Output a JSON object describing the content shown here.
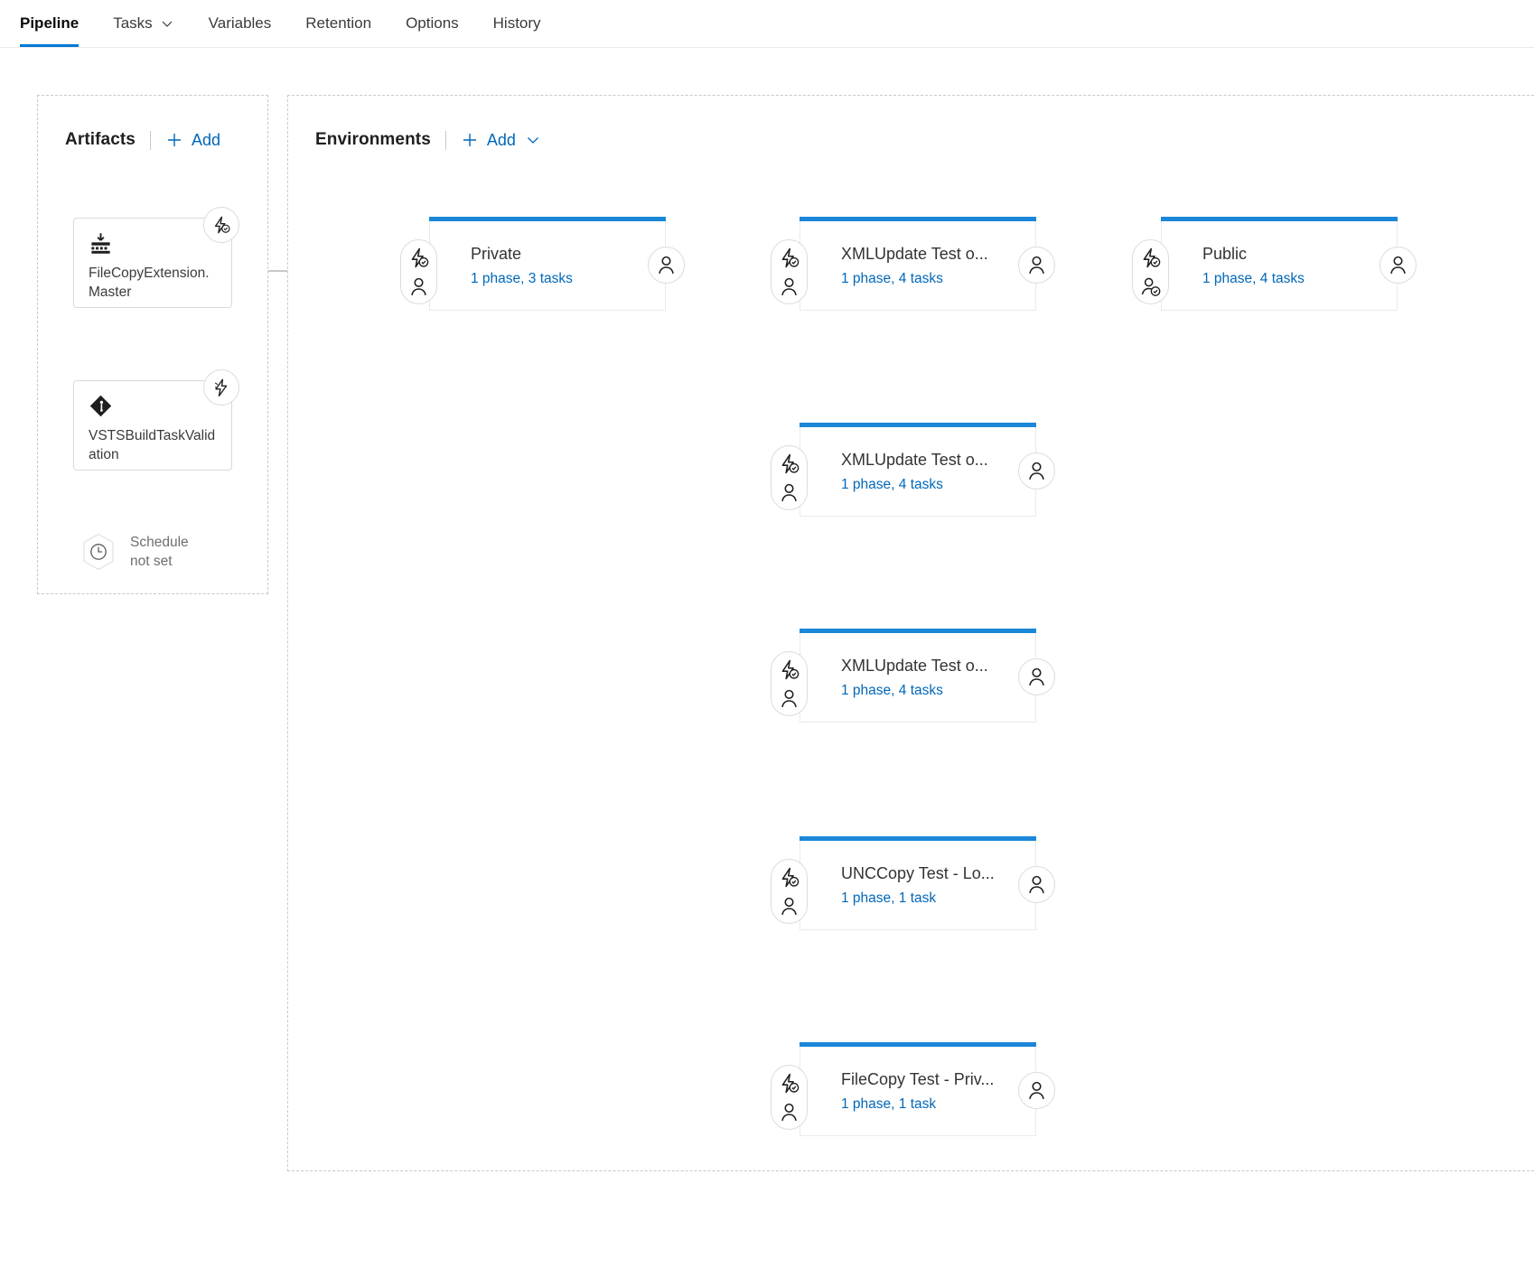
{
  "nav": {
    "items": [
      {
        "label": "Pipeline",
        "active": true,
        "caret": false
      },
      {
        "label": "Tasks",
        "active": false,
        "caret": true
      },
      {
        "label": "Variables",
        "active": false,
        "caret": false
      },
      {
        "label": "Retention",
        "active": false,
        "caret": false
      },
      {
        "label": "Options",
        "active": false,
        "caret": false
      },
      {
        "label": "History",
        "active": false,
        "caret": false
      }
    ]
  },
  "artifacts": {
    "title": "Artifacts",
    "add_label": "Add",
    "items": [
      {
        "name": "FileCopyExtension.Master",
        "icon": "build-artifact-icon",
        "trigger_badge": "lightning-check-icon"
      },
      {
        "name": "VSTSBuildTaskValidation",
        "icon": "git-repository-icon",
        "trigger_badge": "lightning-icon"
      }
    ],
    "schedule": {
      "line1": "Schedule",
      "line2": "not set",
      "icon": "clock-icon"
    }
  },
  "environments": {
    "title": "Environments",
    "add_label": "Add",
    "add_caret": "chevron-down-icon",
    "nodes": [
      {
        "id": "private",
        "title": "Private",
        "subtitle": "1 phase, 3 tasks",
        "pre_icons": [
          "lightning-check-icon",
          "person-icon"
        ],
        "post_icon": "person-icon",
        "accent": "#1b87d8"
      },
      {
        "id": "xmlupdate-1",
        "title": "XMLUpdate Test o...",
        "subtitle": "1 phase, 4 tasks",
        "pre_icons": [
          "lightning-check-icon",
          "person-icon"
        ],
        "post_icon": "person-icon",
        "accent": "#1b87d8"
      },
      {
        "id": "xmlupdate-2",
        "title": "XMLUpdate Test o...",
        "subtitle": "1 phase, 4 tasks",
        "pre_icons": [
          "lightning-check-icon",
          "person-icon"
        ],
        "post_icon": "person-icon",
        "accent": "#1b87d8"
      },
      {
        "id": "xmlupdate-3",
        "title": "XMLUpdate Test o...",
        "subtitle": "1 phase, 4 tasks",
        "pre_icons": [
          "lightning-check-icon",
          "person-icon"
        ],
        "post_icon": "person-icon",
        "accent": "#1b87d8"
      },
      {
        "id": "unccopy",
        "title": "UNCCopy Test - Lo...",
        "subtitle": "1 phase, 1 task",
        "pre_icons": [
          "lightning-check-icon",
          "person-icon"
        ],
        "post_icon": "person-icon",
        "accent": "#1b87d8"
      },
      {
        "id": "filecopy",
        "title": "FileCopy Test - Priv...",
        "subtitle": "1 phase, 1 task",
        "pre_icons": [
          "lightning-check-icon",
          "person-icon"
        ],
        "post_icon": "person-icon",
        "accent": "#1b87d8"
      },
      {
        "id": "public",
        "title": "Public",
        "subtitle": "1 phase, 4 tasks",
        "pre_icons": [
          "lightning-check-icon",
          "person-check-icon"
        ],
        "post_icon": "person-icon",
        "accent": "#1b87d8"
      }
    ]
  },
  "colors": {
    "accent_blue": "#0078d4",
    "link_blue": "#0067b8",
    "env_bar": "#1b87d8",
    "connector": "#b5b5b5",
    "dashed_border": "#c8c8c8"
  }
}
